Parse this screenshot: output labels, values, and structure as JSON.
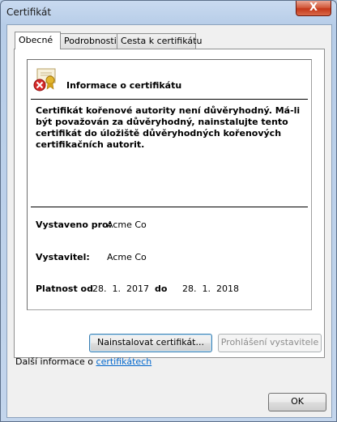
{
  "window": {
    "title": "Certifikát",
    "close_label": "X"
  },
  "tabs": [
    {
      "label": "Obecné"
    },
    {
      "label": "Podrobnosti"
    },
    {
      "label": "Cesta k certifikátu"
    }
  ],
  "cert": {
    "heading": "Informace o certifikátu",
    "warning_line1": "Certifikát kořenové autority není důvěryhodný. Má-li",
    "warning_line2": "být považován za důvěryhodný, nainstalujte tento",
    "warning_line3": "certifikát do úložiště důvěryhodných kořenových",
    "warning_line4": "certifikačních autorit.",
    "issued_to_label": "Vystaveno pro:",
    "issued_to_value": "Acme Co",
    "issuer_label": "Vystavitel:",
    "issuer_value": "Acme Co",
    "validity_label": "Platnost od",
    "valid_from": "28.  1.  2017",
    "validity_to_label": "do",
    "valid_to": "28.  1.  2018"
  },
  "buttons": {
    "install": "Nainstalovat certifikát...",
    "issuer_statement": "Prohlášení vystavitele",
    "ok": "OK"
  },
  "more_info": {
    "text": "Další informace o ",
    "link": "certifikátech"
  },
  "icons": {
    "cert": "certificate-error-icon"
  }
}
